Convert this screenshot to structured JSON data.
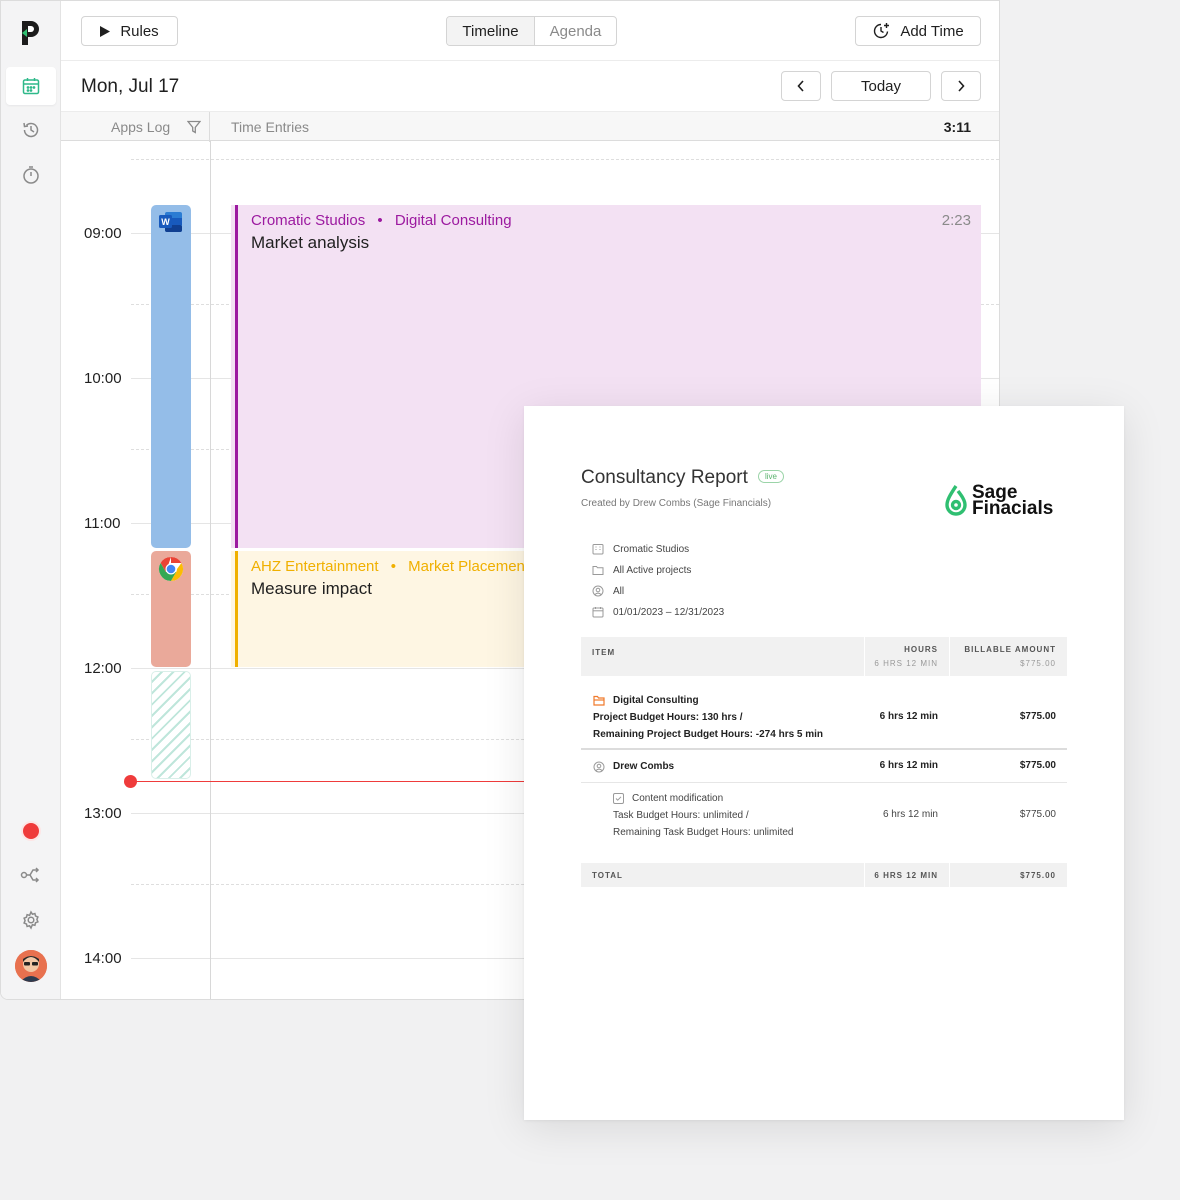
{
  "toolbar": {
    "rules_label": "Rules",
    "view_tabs": [
      "Timeline",
      "Agenda"
    ],
    "add_time_label": "Add Time"
  },
  "datebar": {
    "date": "Mon, Jul 17",
    "today_label": "Today"
  },
  "columns": {
    "apps_log": "Apps Log",
    "time_entries": "Time Entries",
    "total": "3:11"
  },
  "hours": [
    "09:00",
    "10:00",
    "11:00",
    "12:00",
    "13:00",
    "14:00"
  ],
  "entries": [
    {
      "client": "Cromatic Studios",
      "separator": "•",
      "project": "Digital Consulting",
      "title": "Market analysis",
      "duration": "2:23",
      "color": "#9c1aa0",
      "bg": "#f3e1f3"
    },
    {
      "client": "AHZ Entertainment",
      "separator": "•",
      "project": "Market Placemen",
      "title": "Measure impact",
      "duration": "",
      "color": "#f0b000",
      "bg": "#fef6e3"
    }
  ],
  "apps": [
    {
      "icon": "word-icon",
      "color": "#94bde8"
    },
    {
      "icon": "chrome-icon",
      "color": "#eaa99a"
    }
  ],
  "report": {
    "title": "Consultancy Report",
    "badge": "live",
    "created_by": "Created by Drew Combs (Sage Financials)",
    "logo_line1": "Sage",
    "logo_line2": "Finacials",
    "filters": [
      {
        "icon": "building-icon",
        "text": "Cromatic Studios"
      },
      {
        "icon": "folder-icon",
        "text": "All Active projects"
      },
      {
        "icon": "user-circle-icon",
        "text": "All"
      },
      {
        "icon": "calendar-icon",
        "text": "01/01/2023 – 12/31/2023"
      }
    ],
    "table": {
      "col_item": "ITEM",
      "col_hours": "HOURS",
      "col_hours_sub": "6 HRS 12 MIN",
      "col_amount": "BILLABLE AMOUNT",
      "col_amount_sub": "$775.00",
      "project": {
        "name": "Digital Consulting",
        "line2": "Project Budget Hours: 130 hrs /",
        "line3": "Remaining Project Budget Hours: -274 hrs 5 min",
        "hours": "6 hrs 12 min",
        "amount": "$775.00"
      },
      "user": {
        "name": "Drew Combs",
        "hours": "6 hrs 12 min",
        "amount": "$775.00"
      },
      "task": {
        "name": "Content modification",
        "line2": "Task Budget Hours: unlimited /",
        "line3": "Remaining Task Budget Hours: unlimited",
        "hours": "6 hrs 12 min",
        "amount": "$775.00"
      },
      "total_label": "TOTAL",
      "total_hours": "6 HRS 12 MIN",
      "total_amount": "$775.00"
    }
  }
}
